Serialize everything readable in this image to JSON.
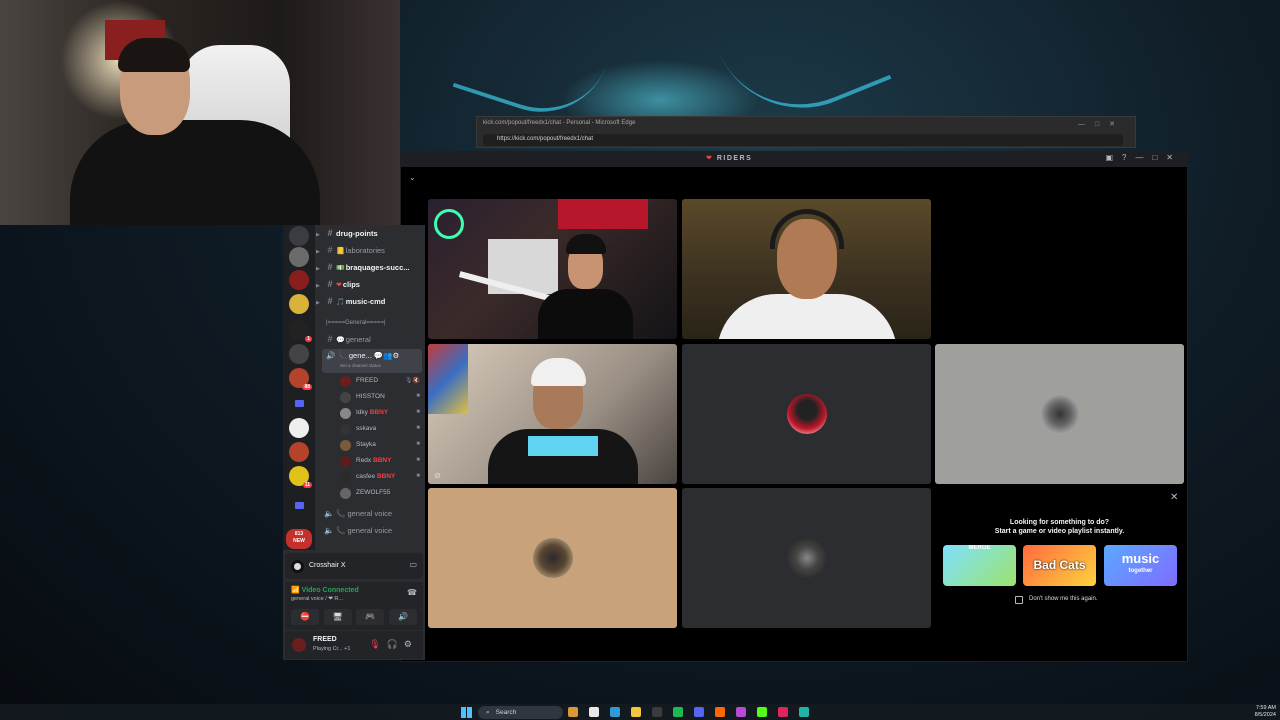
{
  "edge": {
    "title": "kick.com/popout/freedx1/chat - Personal - Microsoft Edge",
    "url": "https://kick.com/popout/freedx1/chat"
  },
  "discord": {
    "window_title": "RIDERS",
    "channels": [
      {
        "name": "drug-points",
        "bright": true,
        "emoji": ""
      },
      {
        "name": "laboratories",
        "bright": false,
        "emoji": "📒"
      },
      {
        "name": "braquages-succ...",
        "bright": true,
        "emoji": "💵"
      },
      {
        "name": "clips",
        "bright": true,
        "emoji": "❤"
      },
      {
        "name": "music-cmd",
        "bright": true,
        "emoji": "🎵"
      }
    ],
    "category": "|=====General=====|",
    "text_general": "general",
    "active_voice": "gene...",
    "channel_status": "Set a channel status",
    "voice_users": [
      {
        "name": "FREED",
        "tag": ""
      },
      {
        "name": "HISSTON",
        "tag": ""
      },
      {
        "name": "Idky",
        "tag": "BBNY"
      },
      {
        "name": "sskava",
        "tag": ""
      },
      {
        "name": "Stayka",
        "tag": ""
      },
      {
        "name": "Redx",
        "tag": "BBNY"
      },
      {
        "name": "casfee",
        "tag": "BBNY"
      },
      {
        "name": "ZEWOLF55",
        "tag": ""
      }
    ],
    "extra_voice": [
      "general voice",
      "general voice"
    ],
    "guild_badges": [
      "1",
      "88",
      "11"
    ],
    "new_badge": {
      "count": "813",
      "label": "NEW"
    },
    "crosshair": "Crosshair X",
    "voice_connected": "Video Connected",
    "voice_sub": "general voice / ❤ R...",
    "user": {
      "name": "FREED",
      "status": "Playing Cr... +1"
    },
    "promo": {
      "line1": "Looking for something to do?",
      "line2": "Start a game or video playlist instantly.",
      "card1": "MERGE",
      "card2": "Bad Cats",
      "card3_top": "music",
      "card3_bottom": "together",
      "optout": "Don't show me this again."
    }
  },
  "taskbar": {
    "search": "Search",
    "time": "7:59 AM",
    "date": "8/5/2024"
  },
  "colors": {
    "discord_bg": "#2b2d31",
    "accent_green": "#23a55a",
    "accent_red": "#f23f43",
    "blurple": "#5865f2"
  }
}
